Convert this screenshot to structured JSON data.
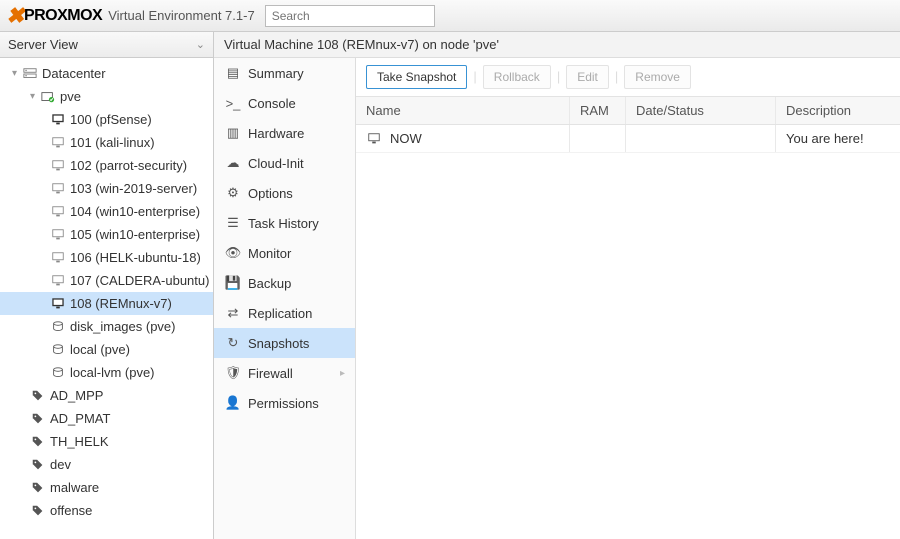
{
  "header": {
    "logo_text": "PROXMOX",
    "env_label": "Virtual Environment 7.1-7",
    "search_placeholder": "Search"
  },
  "sidebar": {
    "panel_title": "Server View",
    "tree": {
      "datacenter_label": "Datacenter",
      "node_label": "pve",
      "vms": [
        {
          "label": "100 (pfSense)"
        },
        {
          "label": "101 (kali-linux)"
        },
        {
          "label": "102 (parrot-security)"
        },
        {
          "label": "103 (win-2019-server)"
        },
        {
          "label": "104 (win10-enterprise)"
        },
        {
          "label": "105 (win10-enterprise)"
        },
        {
          "label": "106 (HELK-ubuntu-18)"
        },
        {
          "label": "107 (CALDERA-ubuntu)"
        },
        {
          "label": "108 (REMnux-v7)"
        }
      ],
      "storages": [
        {
          "label": "disk_images (pve)"
        },
        {
          "label": "local (pve)"
        },
        {
          "label": "local-lvm (pve)"
        }
      ],
      "tags": [
        {
          "label": "AD_MPP"
        },
        {
          "label": "AD_PMAT"
        },
        {
          "label": "TH_HELK"
        },
        {
          "label": "dev"
        },
        {
          "label": "malware"
        },
        {
          "label": "offense"
        }
      ]
    }
  },
  "page_title": "Virtual Machine 108 (REMnux-v7) on node 'pve'",
  "midnav": {
    "items": [
      {
        "label": "Summary"
      },
      {
        "label": "Console"
      },
      {
        "label": "Hardware"
      },
      {
        "label": "Cloud-Init"
      },
      {
        "label": "Options"
      },
      {
        "label": "Task History"
      },
      {
        "label": "Monitor"
      },
      {
        "label": "Backup"
      },
      {
        "label": "Replication"
      },
      {
        "label": "Snapshots"
      },
      {
        "label": "Firewall"
      },
      {
        "label": "Permissions"
      }
    ]
  },
  "toolbar": {
    "take_snapshot": "Take Snapshot",
    "rollback": "Rollback",
    "edit": "Edit",
    "remove": "Remove"
  },
  "table": {
    "headers": {
      "name": "Name",
      "ram": "RAM",
      "date": "Date/Status",
      "desc": "Description"
    },
    "rows": [
      {
        "name": "NOW",
        "ram": "",
        "date": "",
        "desc": "You are here!"
      }
    ]
  }
}
